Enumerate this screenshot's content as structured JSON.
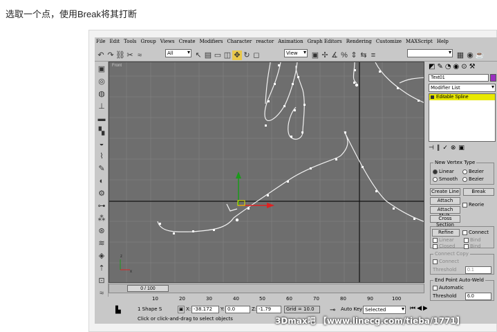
{
  "caption": "选取一个点，使用Break将其打断",
  "menu": [
    "File",
    "Edit",
    "Tools",
    "Group",
    "Views",
    "Create",
    "Modifiers",
    "Character",
    "reactor",
    "Animation",
    "Graph Editors",
    "Rendering",
    "Customize",
    "MAXScript",
    "Help"
  ],
  "toolbar": {
    "selection_filter": "All",
    "ref_coord": "View",
    "icons": [
      "undo-icon",
      "redo-icon",
      "link-icon",
      "unlink-icon",
      "bind-icon",
      "select-icon",
      "select-by-name-icon",
      "region-icon",
      "window-icon",
      "move-icon",
      "rotate-icon",
      "scale-icon",
      "pivot-icon",
      "snap-icon",
      "angle-snap-icon",
      "percent-snap-icon",
      "spinner-snap-icon",
      "mirror-icon",
      "align-icon",
      "render-icon"
    ]
  },
  "viewport": {
    "label": "Front"
  },
  "left_toolbar_icons": [
    "create-icon",
    "modify-icon",
    "hierarchy-icon",
    "motion-icon",
    "display-icon",
    "utilities-icon",
    "light-icon",
    "camera-icon",
    "helper-icon",
    "shape-icon",
    "spacewarp-icon",
    "system-icon",
    "particle-icon",
    "reactor-icon",
    "cloth-icon",
    "rigid-icon",
    "rope-icon",
    "spring-icon",
    "wind-icon",
    "motor-icon"
  ],
  "command_panel": {
    "object_name": "Text01",
    "modifier_list": "Modifier List",
    "stack_item": "Editable Spline",
    "new_vertex_type": {
      "title": "New Vertex Type",
      "options": [
        "Linear",
        "Bezier",
        "Smooth",
        "Bezier"
      ]
    },
    "buttons": {
      "create_line": "Create Line",
      "break": "Break",
      "attach": "Attach",
      "attach_mult": "Attach Mult.",
      "reorient": "Reorie",
      "cross_section": "Cross Section",
      "refine": "Refine",
      "connect": "Connect"
    },
    "refine_opts": [
      "Linear",
      "Bind",
      "Closed",
      "Bind"
    ],
    "connect_copy": {
      "title": "Connect Copy",
      "connect": "Connect",
      "threshold_label": "Threshold",
      "threshold_value": "0.1"
    },
    "endpoint_weld": {
      "title": "End Point Auto-Weld",
      "automatic": "Automatic",
      "threshold_label": "Threshold",
      "threshold_value": "6.0"
    }
  },
  "timeslider": {
    "label": "0 / 100"
  },
  "ruler_ticks": [
    "10",
    "20",
    "30",
    "40",
    "50",
    "60",
    "70",
    "80",
    "90",
    "100"
  ],
  "status": {
    "selected": "1 Shape S",
    "x_label": "X:",
    "x_value": "-38.172",
    "y_label": "Y:",
    "y_value": "0.0",
    "z_label": "Z:",
    "z_value": "-1.79",
    "grid": "Grid = 10.0",
    "auto_key": "Auto Key",
    "set_key_filter": "Selected",
    "prompt": "Click or click-and-drag to select objects"
  },
  "watermark": "3Dmax吧 【www.linecg.com/tieba/1771】"
}
